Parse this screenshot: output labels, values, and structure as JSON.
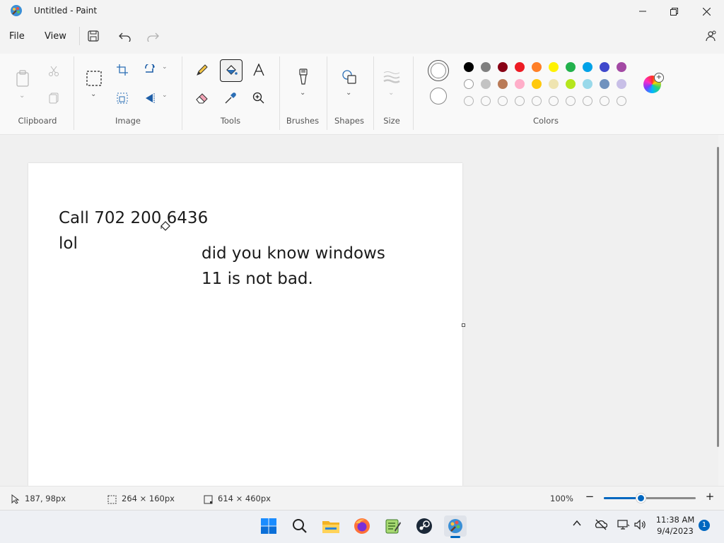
{
  "window": {
    "title": "Untitled - Paint"
  },
  "menu": {
    "file": "File",
    "view": "View"
  },
  "ribbon": {
    "groups": {
      "clipboard": "Clipboard",
      "image": "Image",
      "tools": "Tools",
      "brushes": "Brushes",
      "shapes": "Shapes",
      "size": "Size",
      "colors": "Colors"
    }
  },
  "colors": {
    "row1": [
      "#000000",
      "#7f7f7f",
      "#880015",
      "#ed1c24",
      "#ff7f27",
      "#fff200",
      "#22b14c",
      "#00a2e8",
      "#3f48cc",
      "#a349a4"
    ],
    "row2": [
      "#ffffff",
      "#c3c3c3",
      "#b97a57",
      "#ffaec9",
      "#ffc90e",
      "#efe4b0",
      "#b5e61d",
      "#99d9ea",
      "#7092be",
      "#c8bfe7"
    ]
  },
  "canvas": {
    "line1": "Call 702 200 6436",
    "line2": "lol",
    "line3": "did you know windows",
    "line4": "11 is not bad."
  },
  "status": {
    "cursor": "187, 98px",
    "selection": "264 × 160px",
    "canvas_size": "614 × 460px",
    "zoom": "100%",
    "zoom_fraction": 0.4
  },
  "taskbar": {
    "time": "11:38 AM",
    "date": "9/4/2023",
    "notifications": "1"
  }
}
